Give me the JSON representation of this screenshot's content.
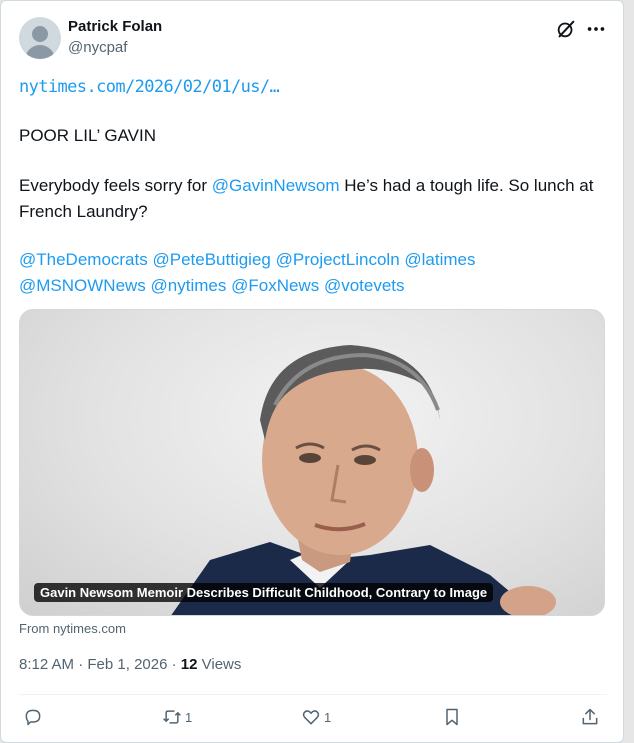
{
  "author": {
    "display_name": "Patrick Folan",
    "handle": "@nycpaf"
  },
  "icons": {
    "avatar": "default-avatar-icon",
    "grok": "grok-icon",
    "more": "more-icon",
    "reply": "reply-icon",
    "retweet": "retweet-icon",
    "like": "like-icon",
    "bookmark": "bookmark-icon",
    "share": "share-icon"
  },
  "post": {
    "url": "nytimes.com/2026/02/01/us/…",
    "line1": "POOR LIL’ GAVIN",
    "line2_before": "Everybody feels sorry for ",
    "line2_mention": "@GavinNewsom",
    "line2_after": " He’s had a tough life. So lunch at French Laundry?",
    "mentions": [
      "@TheDemocrats",
      "@PeteButtigieg",
      "@ProjectLincoln",
      "@latimes",
      "@MSNOWNews",
      "@nytimes",
      "@FoxNews",
      "@votevets"
    ]
  },
  "card": {
    "caption": "Gavin Newsom Memoir Describes Difficult Childhood, Contrary to Image",
    "source": "From nytimes.com"
  },
  "meta": {
    "time": "8:12 AM",
    "separator1": " · ",
    "date": "Feb 1, 2026",
    "separator2": " · ",
    "views_count": "12",
    "views_label": " Views"
  },
  "actions": {
    "reply_count": "",
    "retweet_count": "1",
    "like_count": "1"
  },
  "colors": {
    "link": "#1d9bf0",
    "secondary_text": "#536471",
    "primary_text": "#0f1419"
  }
}
